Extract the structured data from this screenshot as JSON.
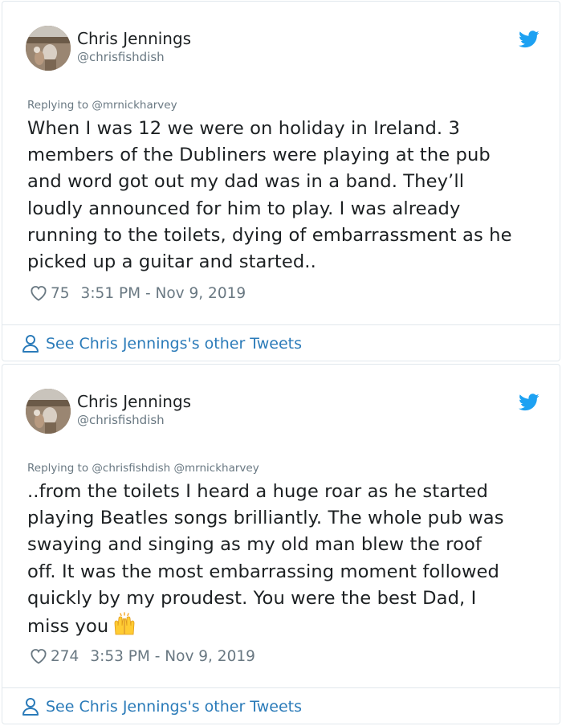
{
  "tweets": [
    {
      "author_name": "Chris Jennings",
      "author_handle": "@chrisfishdish",
      "replying_prefix": "Replying to",
      "replying_to": "@mrnickharvey",
      "text_lines": [
        "When I was 12 we were on holiday in Ireland. 3",
        "members of the Dubliners were playing at the pub",
        "and word got out my dad was in a band. They’ll",
        "loudly announced for him to play. I was already",
        "running to the toilets, dying of embarrassment as he",
        "picked up a guitar and started.."
      ],
      "likes": "75",
      "timestamp": "3:51 PM - Nov 9, 2019",
      "footer_link": "See Chris Jennings's other Tweets"
    },
    {
      "author_name": "Chris Jennings",
      "author_handle": "@chrisfishdish",
      "replying_prefix": "Replying to",
      "replying_to": "@chrisfishdish @mrnickharvey",
      "text_lines": [
        "..from the toilets I heard a huge roar as he started",
        "playing Beatles songs brilliantly. The whole pub was",
        "swaying and singing as my old man blew the roof",
        "off. It was the most embarrassing moment followed",
        "quickly by my proudest. You were the best Dad, I",
        "miss you"
      ],
      "emoji": "raising-hands",
      "likes": "274",
      "timestamp": "3:53 PM - Nov 9, 2019",
      "footer_link": "See Chris Jennings's other Tweets"
    }
  ],
  "colors": {
    "text": "#1c2022",
    "muted": "#697882",
    "link": "#2b7bb9",
    "twitter_blue": "#1da1f2",
    "border": "#e1e8ed"
  },
  "icons": [
    "twitter-bird-icon",
    "heart-icon",
    "person-icon",
    "raising-hands-emoji"
  ]
}
